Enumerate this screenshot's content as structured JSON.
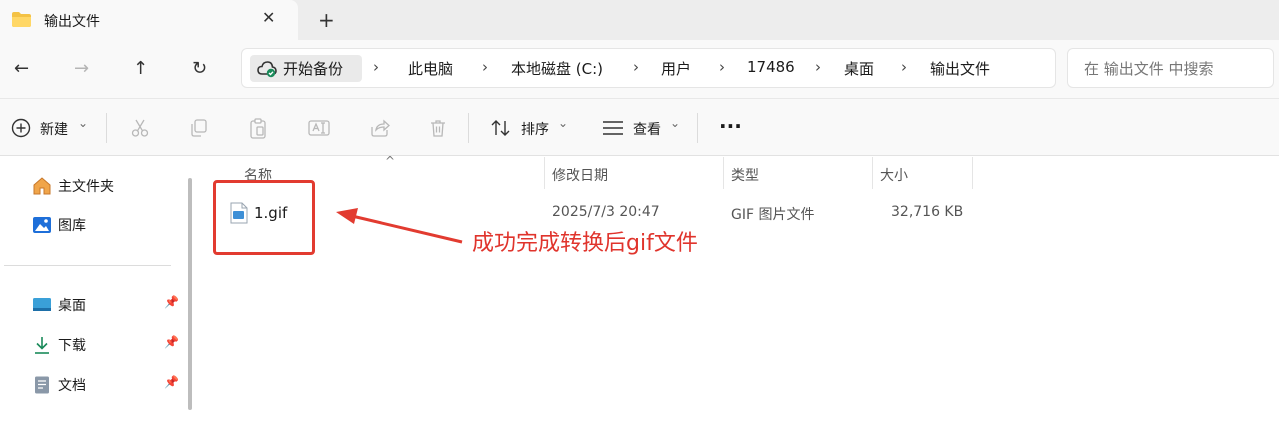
{
  "window": {
    "tab_title": "输出文件",
    "close_glyph": "✕",
    "new_tab_glyph": "+"
  },
  "nav": {
    "back": "←",
    "forward": "→",
    "up": "↑",
    "refresh": "↻",
    "home_label": "开始备份",
    "separator": "›",
    "breadcrumbs": [
      "此电脑",
      "本地磁盘 (C:)",
      "用户",
      "17486",
      "桌面",
      "输出文件"
    ],
    "search_placeholder": "在 输出文件 中搜索"
  },
  "toolbar": {
    "new_label": "新建",
    "sort_label": "排序",
    "view_label": "查看",
    "more_glyph": "···",
    "dropdown_glyph": "⌄"
  },
  "sidebar": {
    "pin_glyph": "📌",
    "items": [
      {
        "label": "主文件夹",
        "icon": "home-icon"
      },
      {
        "label": "图库",
        "icon": "gallery-icon"
      },
      {
        "label": "桌面",
        "icon": "desktop-icon",
        "pinned": true
      },
      {
        "label": "下载",
        "icon": "download-icon",
        "pinned": true
      },
      {
        "label": "文档",
        "icon": "document-icon",
        "pinned": true
      }
    ]
  },
  "file_list": {
    "sort_caret": "^",
    "columns": [
      "名称",
      "修改日期",
      "类型",
      "大小"
    ],
    "rows": [
      {
        "name": "1.gif",
        "modified": "2025/7/3 20:47",
        "type": "GIF 图片文件",
        "size": "32,716 KB"
      }
    ]
  },
  "annotation": {
    "text": "成功完成转换后gif文件",
    "color": "#e0342c"
  }
}
